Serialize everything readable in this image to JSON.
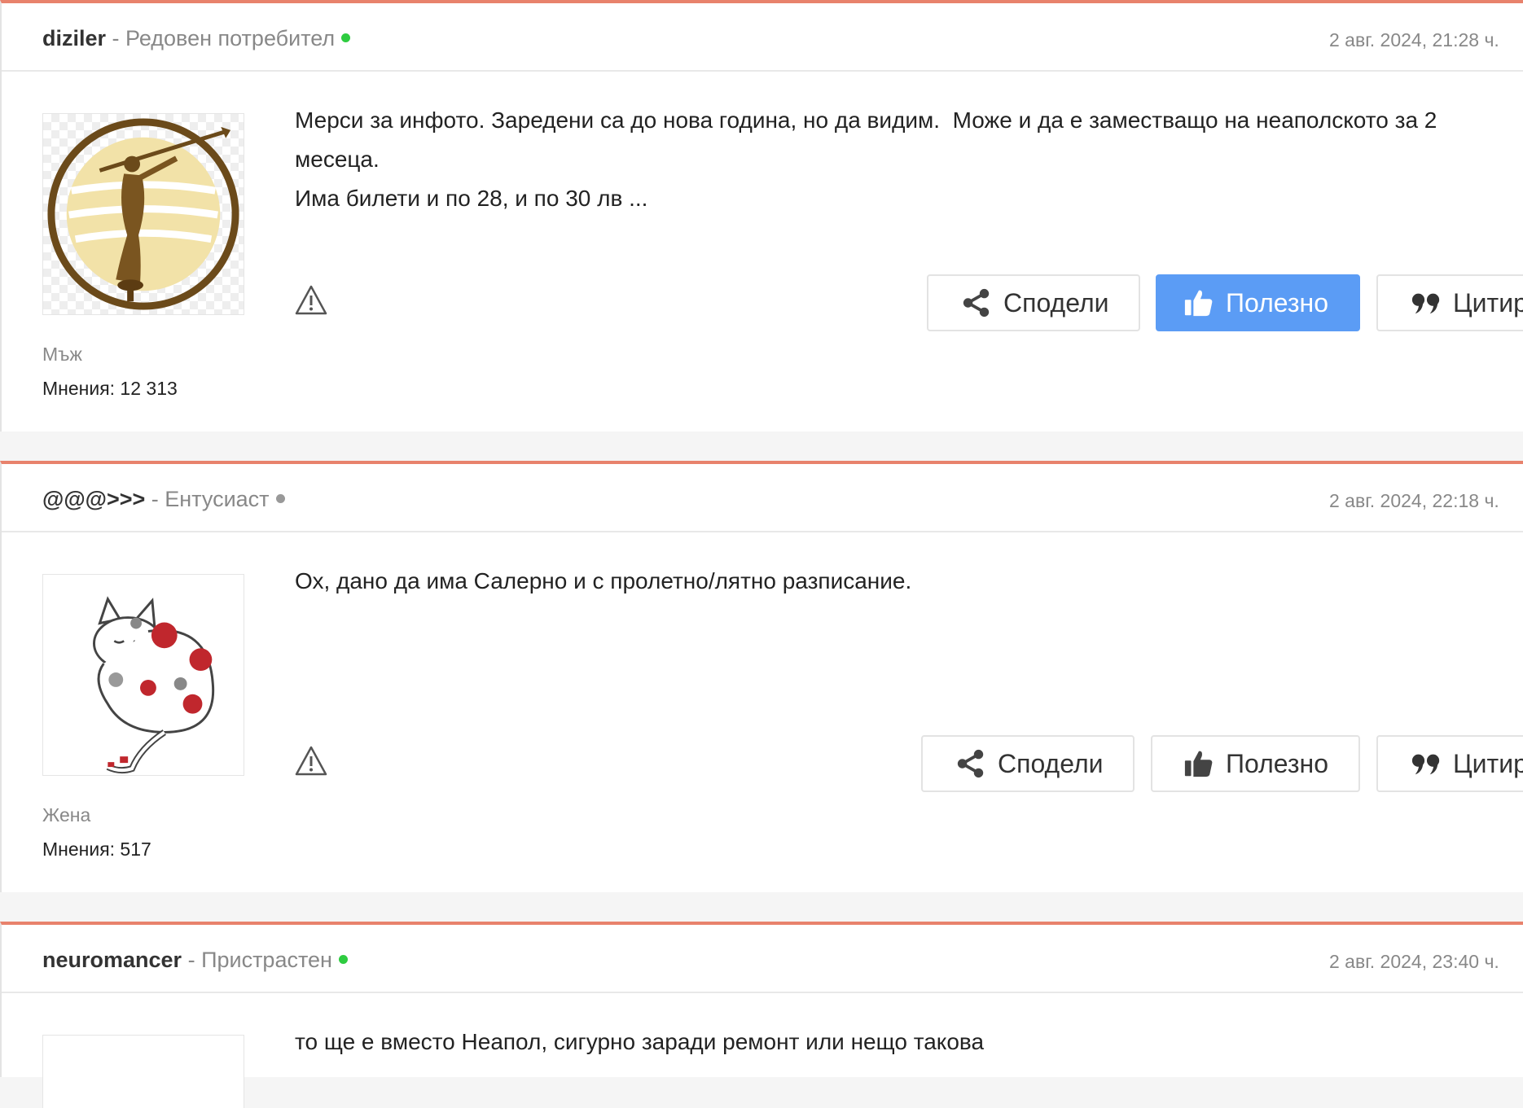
{
  "posts": [
    {
      "username": "diziler",
      "rank": "Редовен потребител",
      "online": true,
      "date": "2 авг. 2024, 21:28 ч.",
      "avatar_icon": "trumpet-angel-statue-icon",
      "body": "Мерси за инфото. Заредени са до нова година, но да видим.  Може и да е заместващо на неаполското за 2\nмесеца.\nИма билети и по 28, и по 30 лв ...",
      "gender": "Мъж",
      "opinions": "Мнения: 12 313",
      "useful_active": true
    },
    {
      "username": "@@@>>>",
      "rank": "Ентусиаст",
      "online": false,
      "date": "2 авг. 2024, 22:18 ч.",
      "avatar_icon": "sleeping-cat-icon",
      "body": "Ох, дано да има Салерно и с пролетно/лятно разписание.",
      "gender": "Жена",
      "opinions": "Мнения: 517",
      "useful_active": false
    },
    {
      "username": "neuromancer",
      "rank": "Пристрастен",
      "online": true,
      "date": "2 авг. 2024, 23:40 ч.",
      "body": "то ще е вместо Неапол, сигурно заради ремонт или нещо такова"
    }
  ],
  "separator": " - ",
  "actions": {
    "share": "Сподели",
    "useful": "Полезно",
    "quote": "Цитирай"
  },
  "colors": {
    "accent_border": "#e8826c",
    "online_dot": "#2ecc40",
    "offline_dot": "#999999",
    "useful_active_bg": "#5b9cf5"
  }
}
